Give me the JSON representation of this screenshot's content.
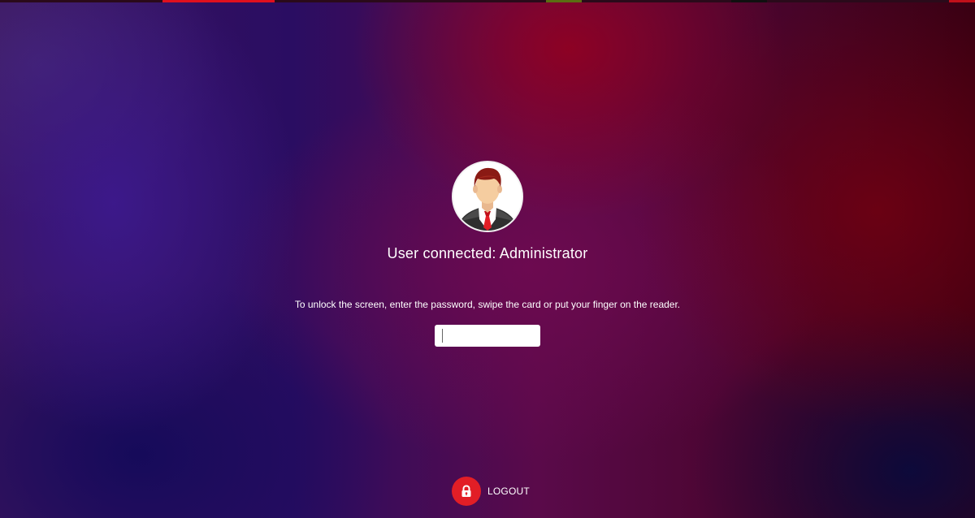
{
  "lock_screen": {
    "title": "User connected: Administrator",
    "instructions": "To unlock the screen, enter the password, swipe the card or put your finger on the reader.",
    "password_field": {
      "value": "",
      "placeholder": ""
    },
    "avatar_icon": "user-avatar-icon",
    "logout": {
      "label": "LOGOUT",
      "icon": "lock-icon"
    }
  },
  "colors": {
    "accent": "#e21e26",
    "text": "#ffffff",
    "field_background": "#ffffff",
    "background_blue": "#2a0d62",
    "background_red": "#8a0022"
  }
}
